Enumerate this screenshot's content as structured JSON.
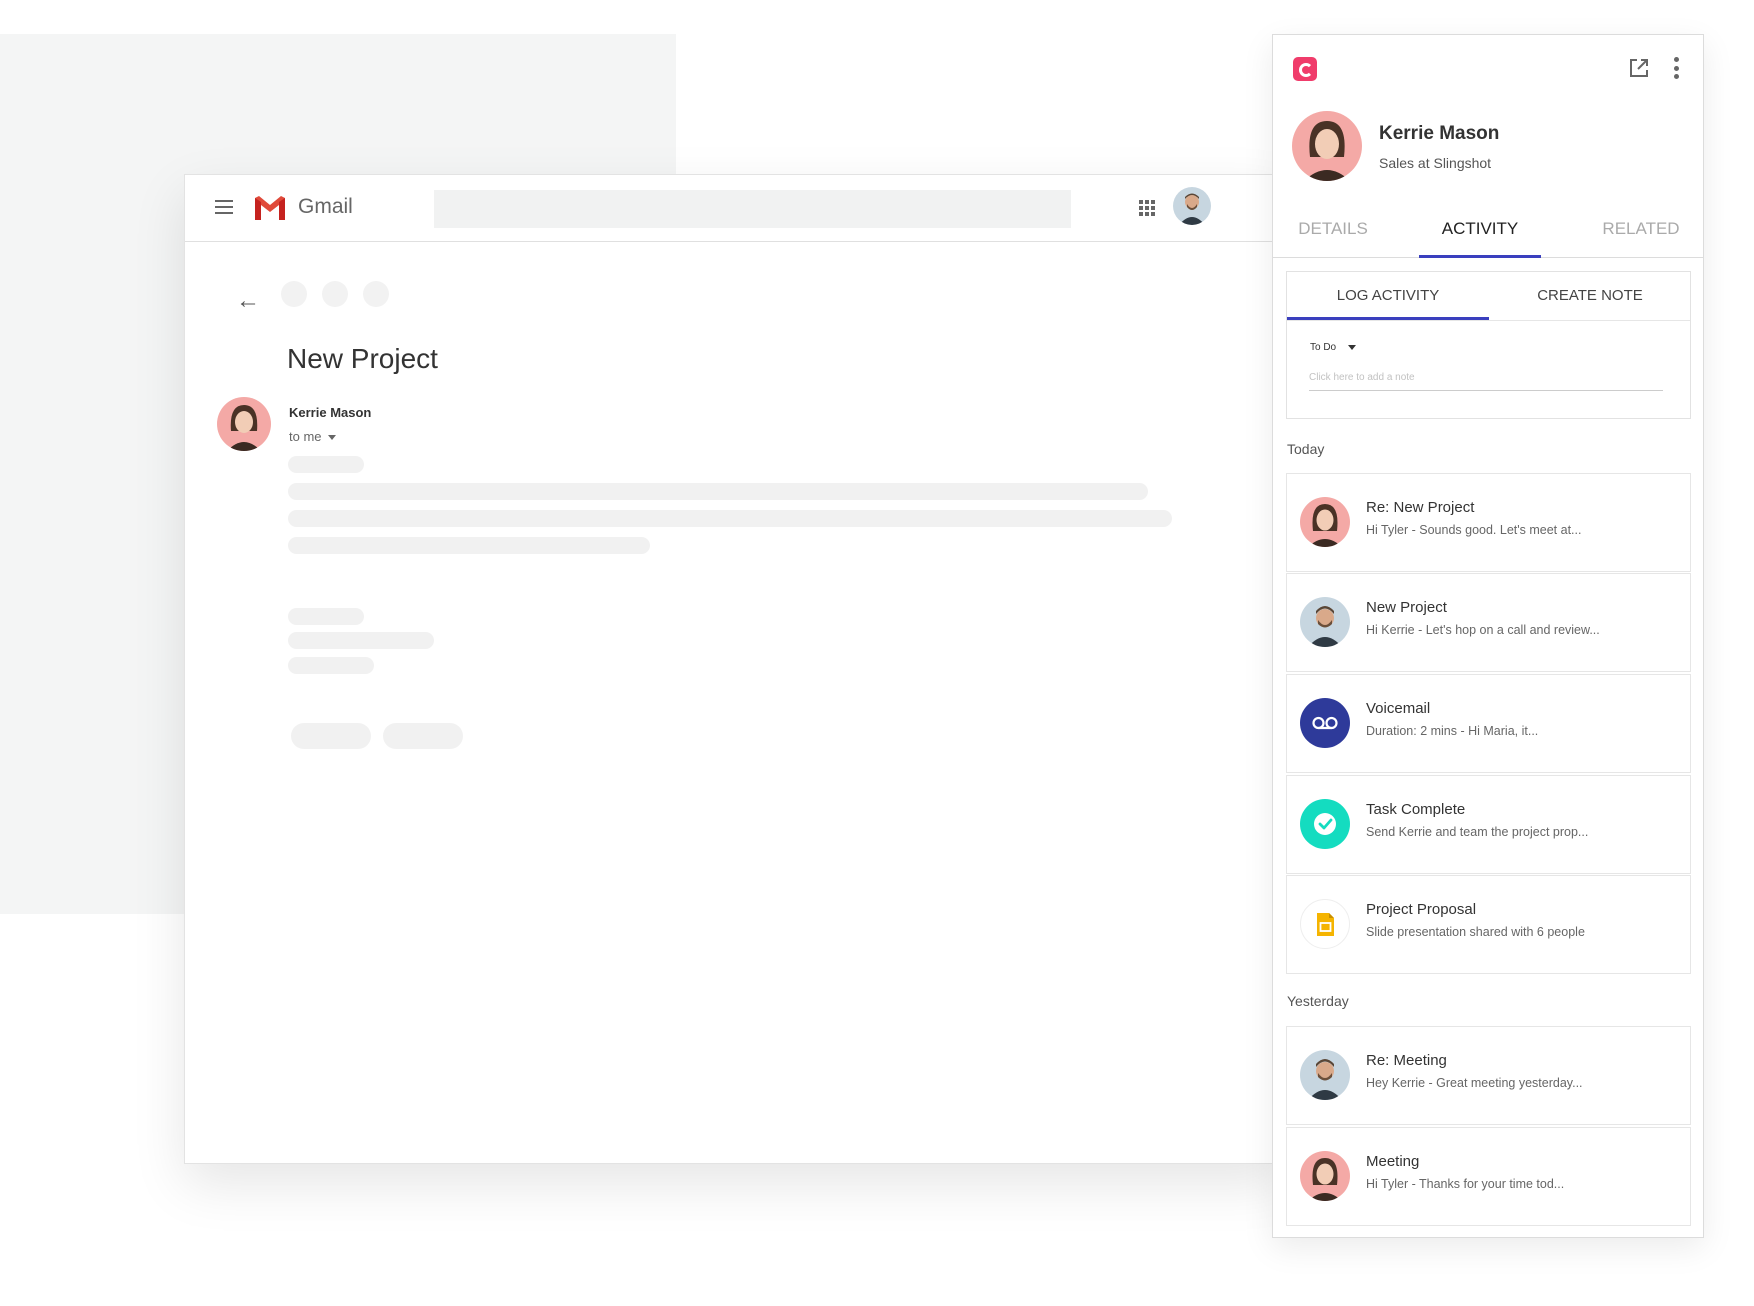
{
  "gmail": {
    "app_title": "Gmail",
    "email_subject": "New Project",
    "sender_name": "Kerrie Mason",
    "recipient": "to me"
  },
  "panel": {
    "contact": {
      "name": "Kerrie Mason",
      "title": "Sales at Slingshot"
    },
    "tabs": [
      {
        "label": "DETAILS"
      },
      {
        "label": "ACTIVITY"
      },
      {
        "label": "RELATED"
      }
    ],
    "log_tabs": [
      {
        "label": "LOG ACTIVITY"
      },
      {
        "label": "CREATE NOTE"
      }
    ],
    "todo_label": "To Do",
    "note_placeholder": "Click here to add a note",
    "today_label": "Today",
    "yesterday_label": "Yesterday",
    "activities_today": [
      {
        "title": "Re: New Project",
        "subtitle": "Hi Tyler -  Sounds good. Let's meet at...",
        "icon": "avatar-woman"
      },
      {
        "title": "New Project",
        "subtitle": "Hi Kerrie - Let's hop on a call and review...",
        "icon": "avatar-man"
      },
      {
        "title": "Voicemail",
        "subtitle": "Duration: 2 mins -  Hi Maria, it...",
        "icon": "voicemail-icon"
      },
      {
        "title": "Task Complete",
        "subtitle": "Send Kerrie and team the project prop...",
        "icon": "check-icon"
      },
      {
        "title": "Project Proposal",
        "subtitle": "Slide presentation shared with 6 people",
        "icon": "slides-icon"
      }
    ],
    "activities_yesterday": [
      {
        "title": "Re: Meeting",
        "subtitle": "Hey Kerrie - Great meeting yesterday...",
        "icon": "avatar-man"
      },
      {
        "title": "Meeting",
        "subtitle": "Hi Tyler - Thanks for your time tod...",
        "icon": "avatar-woman"
      }
    ]
  },
  "colors": {
    "accent": "#3a3fbe",
    "brand": "#f03c6b",
    "voicemail": "#2e3a9a",
    "task": "#14dcc0",
    "slides": "#f5b400"
  }
}
